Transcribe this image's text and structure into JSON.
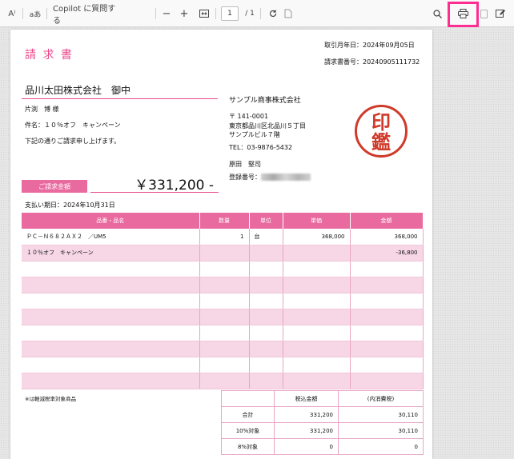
{
  "toolbar": {
    "read_aloud_icon": "A⁾",
    "text_icon": "aあ",
    "copilot_label": "Copilot に質問する",
    "zoom_out": "−",
    "zoom_in": "+",
    "current_page": "1",
    "total_pages": "/ 1"
  },
  "invoice": {
    "title": "請 求 書",
    "transaction_date": "取引月年日：2024年09月05日",
    "invoice_number": "請求書番号：20240905111732",
    "client_company": "品川太田株式会社　御中",
    "client_contact": "片渕　博 様",
    "subject": "件名：１０％オフ　キャンペーン",
    "request_text": "下記の通りご請求申し上げます。",
    "amount_label": "ご請求金額",
    "amount_value": "￥331,200 -",
    "due_date": "支払い期日：2024年10月31日",
    "issuer": {
      "company": "サンプル商事株式会社",
      "postal": "〒 141-0001",
      "address1": "東京都品川区北品川５丁目",
      "address2": "サンプルビル７階",
      "tel": "TEL：03-9876-5432",
      "person": "原田　堅司",
      "registration_label": "登録番号："
    },
    "stamp_line1": "印",
    "stamp_line2": "鑑",
    "table": {
      "headers": [
        "品番・品名",
        "数量",
        "単位",
        "単価",
        "金額"
      ],
      "rows": [
        {
          "name": "ＰＣ－Ｎ６８２ＡＸ２　／UM5",
          "qty": "1",
          "unit": "台",
          "price": "368,000",
          "amount": "368,000"
        },
        {
          "name": "１０％オフ　キャンペーン",
          "qty": "",
          "unit": "",
          "price": "",
          "amount": "-36,800"
        }
      ]
    },
    "reduced_tax_note": "※は軽減税率対象商品",
    "summary": {
      "col1": "税込金額",
      "col2": "(内消費税)",
      "rows": [
        {
          "label": "合計",
          "incl": "331,200",
          "tax": "30,110"
        },
        {
          "label": "10%対象",
          "incl": "331,200",
          "tax": "30,110"
        },
        {
          "label": "8%対象",
          "incl": "0",
          "tax": "0"
        }
      ]
    }
  }
}
